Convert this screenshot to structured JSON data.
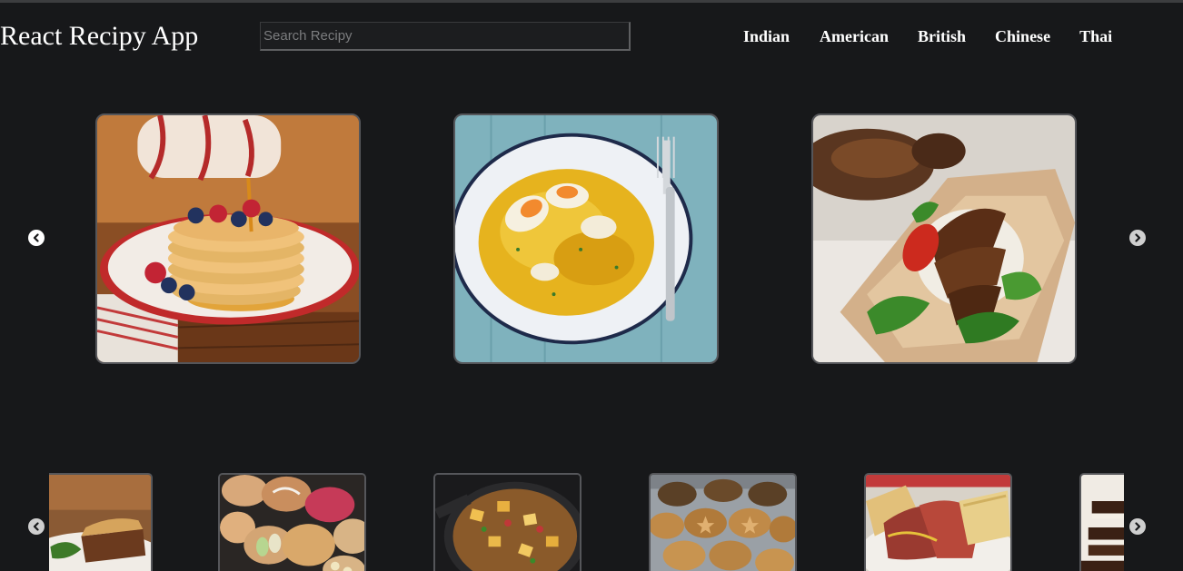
{
  "header": {
    "app_title": "React Recipy App",
    "search_placeholder": "Search Recipy",
    "search_value": "",
    "nav": [
      "Indian",
      "American",
      "British",
      "Chinese",
      "Thai"
    ]
  },
  "featured_carousel": {
    "prev_icon": "chevron-left-icon",
    "next_icon": "chevron-right-icon",
    "items": [
      "pancakes",
      "kedgeree",
      "chicken-wrap"
    ]
  },
  "recipe_strip": {
    "prev_icon": "chevron-left-icon",
    "next_icon": "chevron-right-icon",
    "items": [
      "meat-pie",
      "tarts",
      "skillet-potatoes",
      "mince-pies",
      "salt-beef-sandwich",
      "chocolate-bars"
    ]
  },
  "colors": {
    "background": "#17181a",
    "text": "#ffffff",
    "card_border": "#55565a"
  }
}
